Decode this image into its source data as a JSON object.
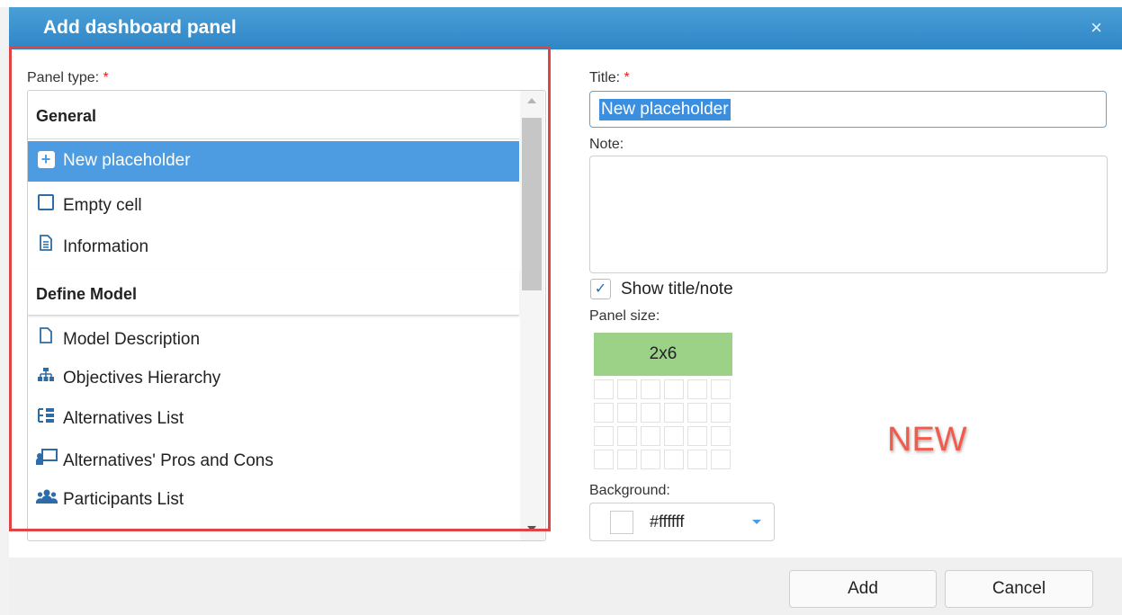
{
  "dialog": {
    "title": "Add dashboard panel",
    "close_symbol": "×"
  },
  "panel_type": {
    "label": "Panel type:",
    "required_mark": "*",
    "groups": [
      {
        "name": "General",
        "items": [
          {
            "label": "New placeholder",
            "icon": "plus-square-icon",
            "selected": true
          },
          {
            "label": "Empty cell",
            "icon": "empty-square-icon",
            "selected": false
          },
          {
            "label": "Information",
            "icon": "document-icon",
            "selected": false
          }
        ]
      },
      {
        "name": "Define Model",
        "items": [
          {
            "label": "Model Description",
            "icon": "page-icon",
            "selected": false
          },
          {
            "label": "Objectives Hierarchy",
            "icon": "hierarchy-icon",
            "selected": false
          },
          {
            "label": "Alternatives List",
            "icon": "list-icon",
            "selected": false
          },
          {
            "label": "Alternatives' Pros and Cons",
            "icon": "presentation-icon",
            "selected": false
          },
          {
            "label": "Participants List",
            "icon": "users-icon",
            "selected": false
          }
        ]
      }
    ]
  },
  "form": {
    "title_label": "Title:",
    "required_mark": "*",
    "title_value": "New placeholder",
    "note_label": "Note:",
    "note_value": "",
    "show_title_note": {
      "label": "Show title/note",
      "checked": true,
      "check_symbol": "✓"
    },
    "panel_size": {
      "label": "Panel size:",
      "value": "2x6",
      "columns": 6,
      "rows": 4
    },
    "background": {
      "label": "Background:",
      "value": "#ffffff",
      "swatch_color": "#ffffff"
    }
  },
  "annotation": {
    "badge": "NEW"
  },
  "footer": {
    "add_label": "Add",
    "cancel_label": "Cancel"
  },
  "colors": {
    "titlebar": "#3a91cf",
    "selected_item": "#4d9be0",
    "highlight_frame": "#e04545",
    "size_fill": "#9bd287",
    "new_badge": "#f25b4b"
  }
}
